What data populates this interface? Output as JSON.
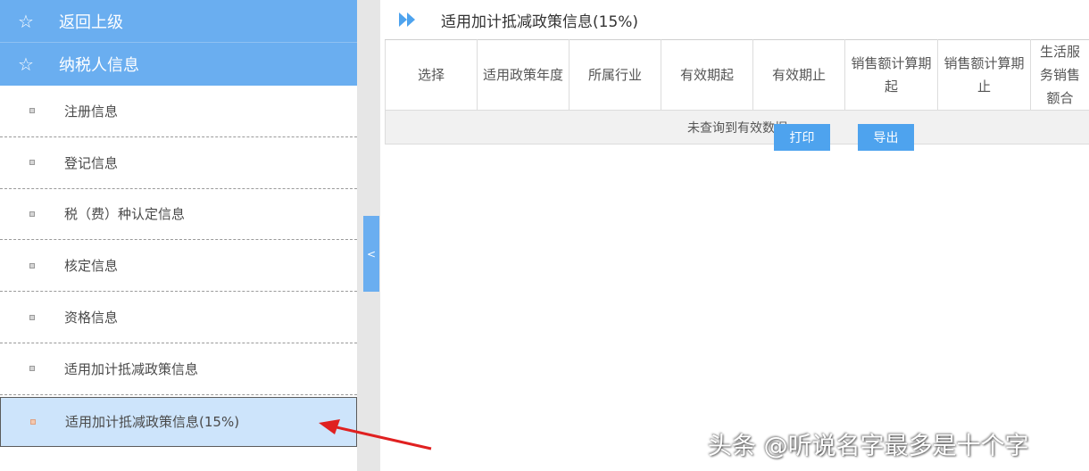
{
  "sidebar": {
    "back": "返回上级",
    "section": "纳税人信息",
    "items": [
      {
        "label": "注册信息"
      },
      {
        "label": "登记信息"
      },
      {
        "label": "税（费）种认定信息"
      },
      {
        "label": "核定信息"
      },
      {
        "label": "资格信息"
      },
      {
        "label": "适用加计抵减政策信息"
      },
      {
        "label": "适用加计抵减政策信息(15%)"
      }
    ],
    "collapse_glyph": "<"
  },
  "main": {
    "title": "适用加计抵减政策信息(15%)",
    "table": {
      "headers": [
        "选择",
        "适用政策年度",
        "所属行业",
        "有效期起",
        "有效期止",
        "销售额计算期起",
        "销售额计算期止",
        "生活服务销售额合"
      ],
      "empty_text": "未查询到有效数据"
    },
    "buttons": {
      "print": "打印",
      "export": "导出"
    }
  },
  "watermark": "头条 @听说名字最多是十个字",
  "colors": {
    "accent": "#6aaef0",
    "button": "#4ea3ee",
    "active_row": "#cde4fb",
    "annotation": "#e02020"
  }
}
